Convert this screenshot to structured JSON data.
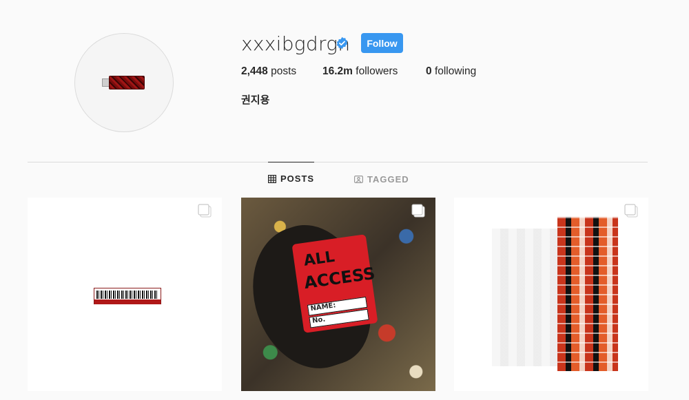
{
  "profile": {
    "username": "xxxibgdrgn",
    "verified": true,
    "follow_label": "Follow",
    "full_name": "권지용",
    "stats": {
      "posts_count": "2,448",
      "posts_label": "posts",
      "followers_count": "16.2m",
      "followers_label": "followers",
      "following_count": "0",
      "following_label": "following"
    }
  },
  "tabs": [
    {
      "label": "POSTS",
      "icon": "grid-icon",
      "active": true
    },
    {
      "label": "TAGGED",
      "icon": "tagged-icon",
      "active": false
    }
  ],
  "posts_card": {
    "line1": "ALL",
    "line2": "ACCESS",
    "field1": "NAME:",
    "field2": "No."
  },
  "colors": {
    "accent": "#3897f0",
    "verified": "#3897f0",
    "text": "#262626",
    "muted": "#999999",
    "border": "#dbdbdb",
    "background": "#fafafa"
  }
}
